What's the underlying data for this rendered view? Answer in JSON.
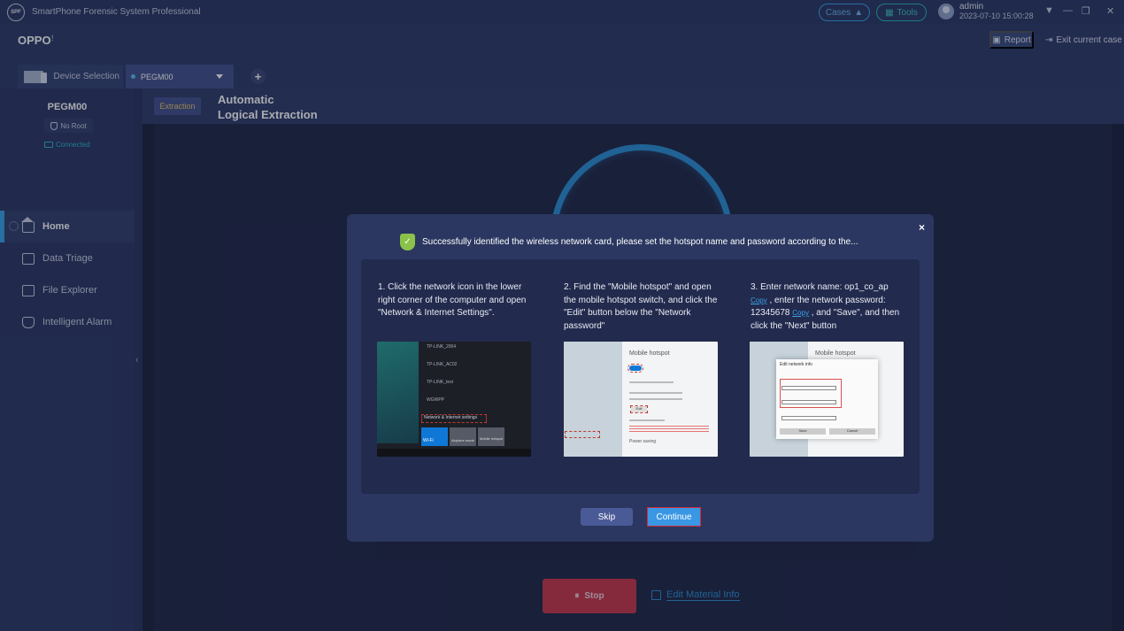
{
  "window": {
    "app_title": "SmartPhone Forensic System Professional",
    "logo_text": "SPF",
    "cases_label": "Cases",
    "tools_label": "Tools",
    "user_name": "admin",
    "datetime": "2023-07-10 15:00:28",
    "controls": {
      "dropdown": "▼",
      "minimize": "—",
      "restore": "❐",
      "close": "✕"
    }
  },
  "header": {
    "brand": "OPPO",
    "brand_mark": "!",
    "report_label": "Report",
    "exit_label": "Exit current case",
    "device_selection_label": "Device Selection",
    "selected_device": "PEGM00",
    "add_tab_label": "+"
  },
  "sidebar": {
    "device_name": "PEGM00",
    "root_status": "No Root",
    "connection_status": "Connected",
    "collapse_icon": "‹",
    "items": [
      {
        "label": "Home",
        "icon": "home-icon",
        "active": true
      },
      {
        "label": "Data Triage",
        "icon": "data-triage-icon",
        "active": false
      },
      {
        "label": "File Explorer",
        "icon": "folder-icon",
        "active": false
      },
      {
        "label": "Intelligent Alarm",
        "icon": "alarm-icon",
        "active": false
      }
    ]
  },
  "main": {
    "tag": "Extraction",
    "title_line1": "Automatic",
    "title_line2": "Logical Extraction",
    "stop_label": "Stop",
    "stop_icon": "⏸",
    "edit_material_label": "Edit Material Info"
  },
  "dialog": {
    "message": "Successfully identified the wireless network card, please set the hotspot name and password according to the...",
    "close_icon": "×",
    "steps": [
      {
        "text": "1. Click the network icon in the lower right corner of the computer and open \"Network & Internet Settings\"."
      },
      {
        "text": "2. Find the \"Mobile hotspot\" and open the mobile hotspot switch, and click the \"Edit\" button below the \"Network password\""
      },
      {
        "text_part1": "3. Enter network name: op1_co_ap",
        "copy_label": "Copy",
        "text_part2": ", enter the network password: 12345678",
        "text_part3": ", and \"Save\", and then click the \"Next\" button"
      }
    ],
    "thumb1": {
      "networks": [
        "TP-LINK_2004",
        "TP-LINK_AC02",
        "TP-LINK_test",
        "WGWPP"
      ],
      "settings_link": "Network & Internet settings",
      "tiles": [
        "Wi-Fi",
        "Airplane mode",
        "Mobile hotspot"
      ]
    },
    "thumb2": {
      "heading": "Mobile hotspot",
      "toggle_label": "On",
      "edit_label": "Edit",
      "section": "Power saving"
    },
    "thumb3": {
      "heading": "Mobile hotspot",
      "modal_title": "Edit network info",
      "save_label": "Save",
      "cancel_label": "Cancel"
    },
    "skip_label": "Skip",
    "continue_label": "Continue"
  }
}
